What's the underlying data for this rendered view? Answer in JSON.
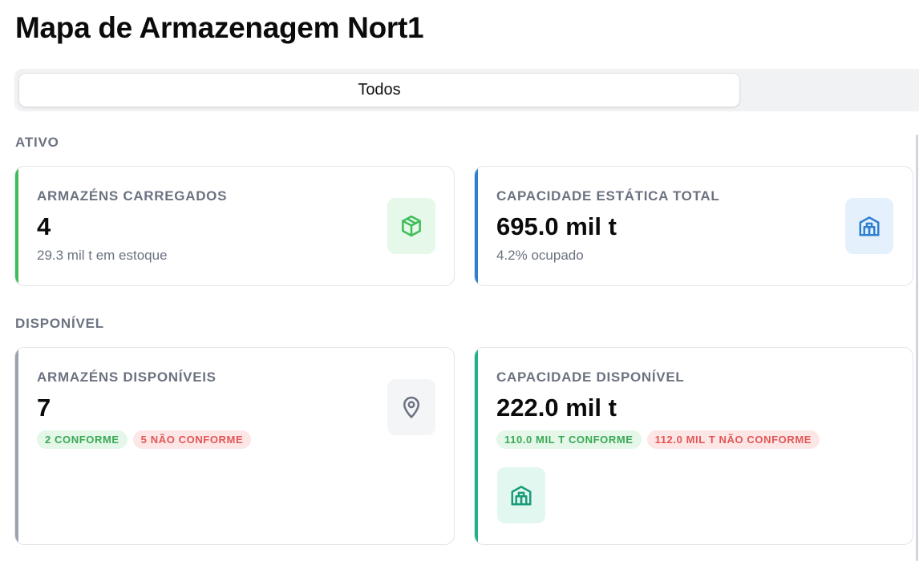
{
  "page": {
    "title": "Mapa de Armazenagem Nort1"
  },
  "filter": {
    "tabs": [
      {
        "label": "Todos",
        "active": true
      }
    ]
  },
  "sections": {
    "ativo": {
      "label": "ATIVO",
      "cards": [
        {
          "label": "ARMAZÉNS CARREGADOS",
          "value": "4",
          "subtitle": "29.3 mil t em estoque",
          "icon": "package-icon",
          "accent": "#3ebd59",
          "icon_bg": "#e5f8e9",
          "icon_color": "#3ebd59"
        },
        {
          "label": "CAPACIDADE ESTÁTICA TOTAL",
          "value": "695.0 mil t",
          "subtitle": "4.2% ocupado",
          "icon": "warehouse-icon",
          "accent": "#2f7fd1",
          "icon_bg": "#e4f1fc",
          "icon_color": "#2f7fd1"
        }
      ]
    },
    "disponivel": {
      "label": "DISPONÍVEL",
      "cards": [
        {
          "label": "ARMAZÉNS DISPONÍVEIS",
          "value": "7",
          "icon": "map-pin-icon",
          "accent": "#9ca3af",
          "icon_bg": "#f4f5f7",
          "icon_color": "#6b7280",
          "badges": [
            {
              "text": "2 CONFORME",
              "type": "success"
            },
            {
              "text": "5 NÃO CONFORME",
              "type": "danger"
            }
          ]
        },
        {
          "label": "CAPACIDADE DISPONÍVEL",
          "value": "222.0 mil t",
          "icon": "warehouse-icon",
          "accent": "#1fb389",
          "icon_bg": "#e2f7f0",
          "icon_color": "#1a9c7a",
          "badges": [
            {
              "text": "110.0 MIL T CONFORME",
              "type": "success"
            },
            {
              "text": "112.0 MIL T NÃO CONFORME",
              "type": "danger"
            }
          ]
        }
      ]
    }
  },
  "colors": {
    "success_bg": "#e4f7e8",
    "success_text": "#3aa955",
    "danger_bg": "#fde6e6",
    "danger_text": "#e25656"
  }
}
